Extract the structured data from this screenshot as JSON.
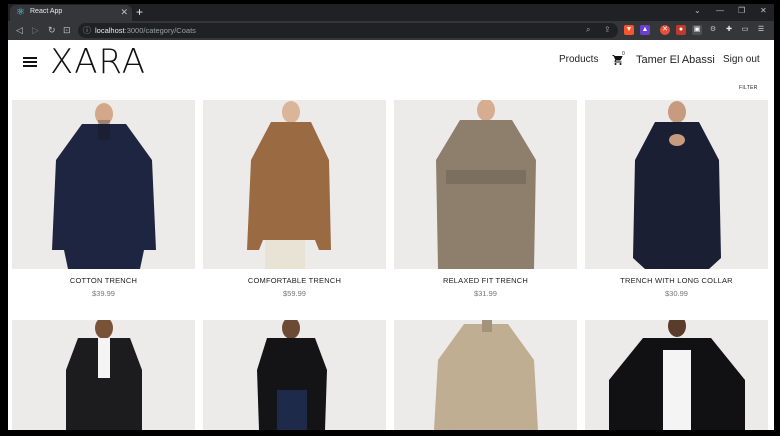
{
  "browser": {
    "tab_title": "React App",
    "url_host": "localhost",
    "url_path": ":3000/category/Coats"
  },
  "header": {
    "logo": "XARA",
    "nav_products": "Products",
    "cart_count": "0",
    "user_name": "Tamer El Abassi",
    "sign_out": "Sign out",
    "filter": "FILTER"
  },
  "products": [
    {
      "name": "COTTON TRENCH",
      "price": "$39.99",
      "coat_color": "#1e2540"
    },
    {
      "name": "COMFORTABLE TRENCH",
      "price": "$59.99",
      "coat_color": "#9a6a43"
    },
    {
      "name": "RELAXED FIT TRENCH",
      "price": "$31.99",
      "coat_color": "#8e7f6c"
    },
    {
      "name": "TRENCH WITH LONG COLLAR",
      "price": "$30.99",
      "coat_color": "#1b1f33"
    },
    {
      "name": "",
      "price": "",
      "coat_color": "#1c1c1e"
    },
    {
      "name": "",
      "price": "",
      "coat_color": "#141416"
    },
    {
      "name": "",
      "price": "",
      "coat_color": "#bfae92"
    },
    {
      "name": "",
      "price": "",
      "coat_color": "#111113"
    }
  ]
}
